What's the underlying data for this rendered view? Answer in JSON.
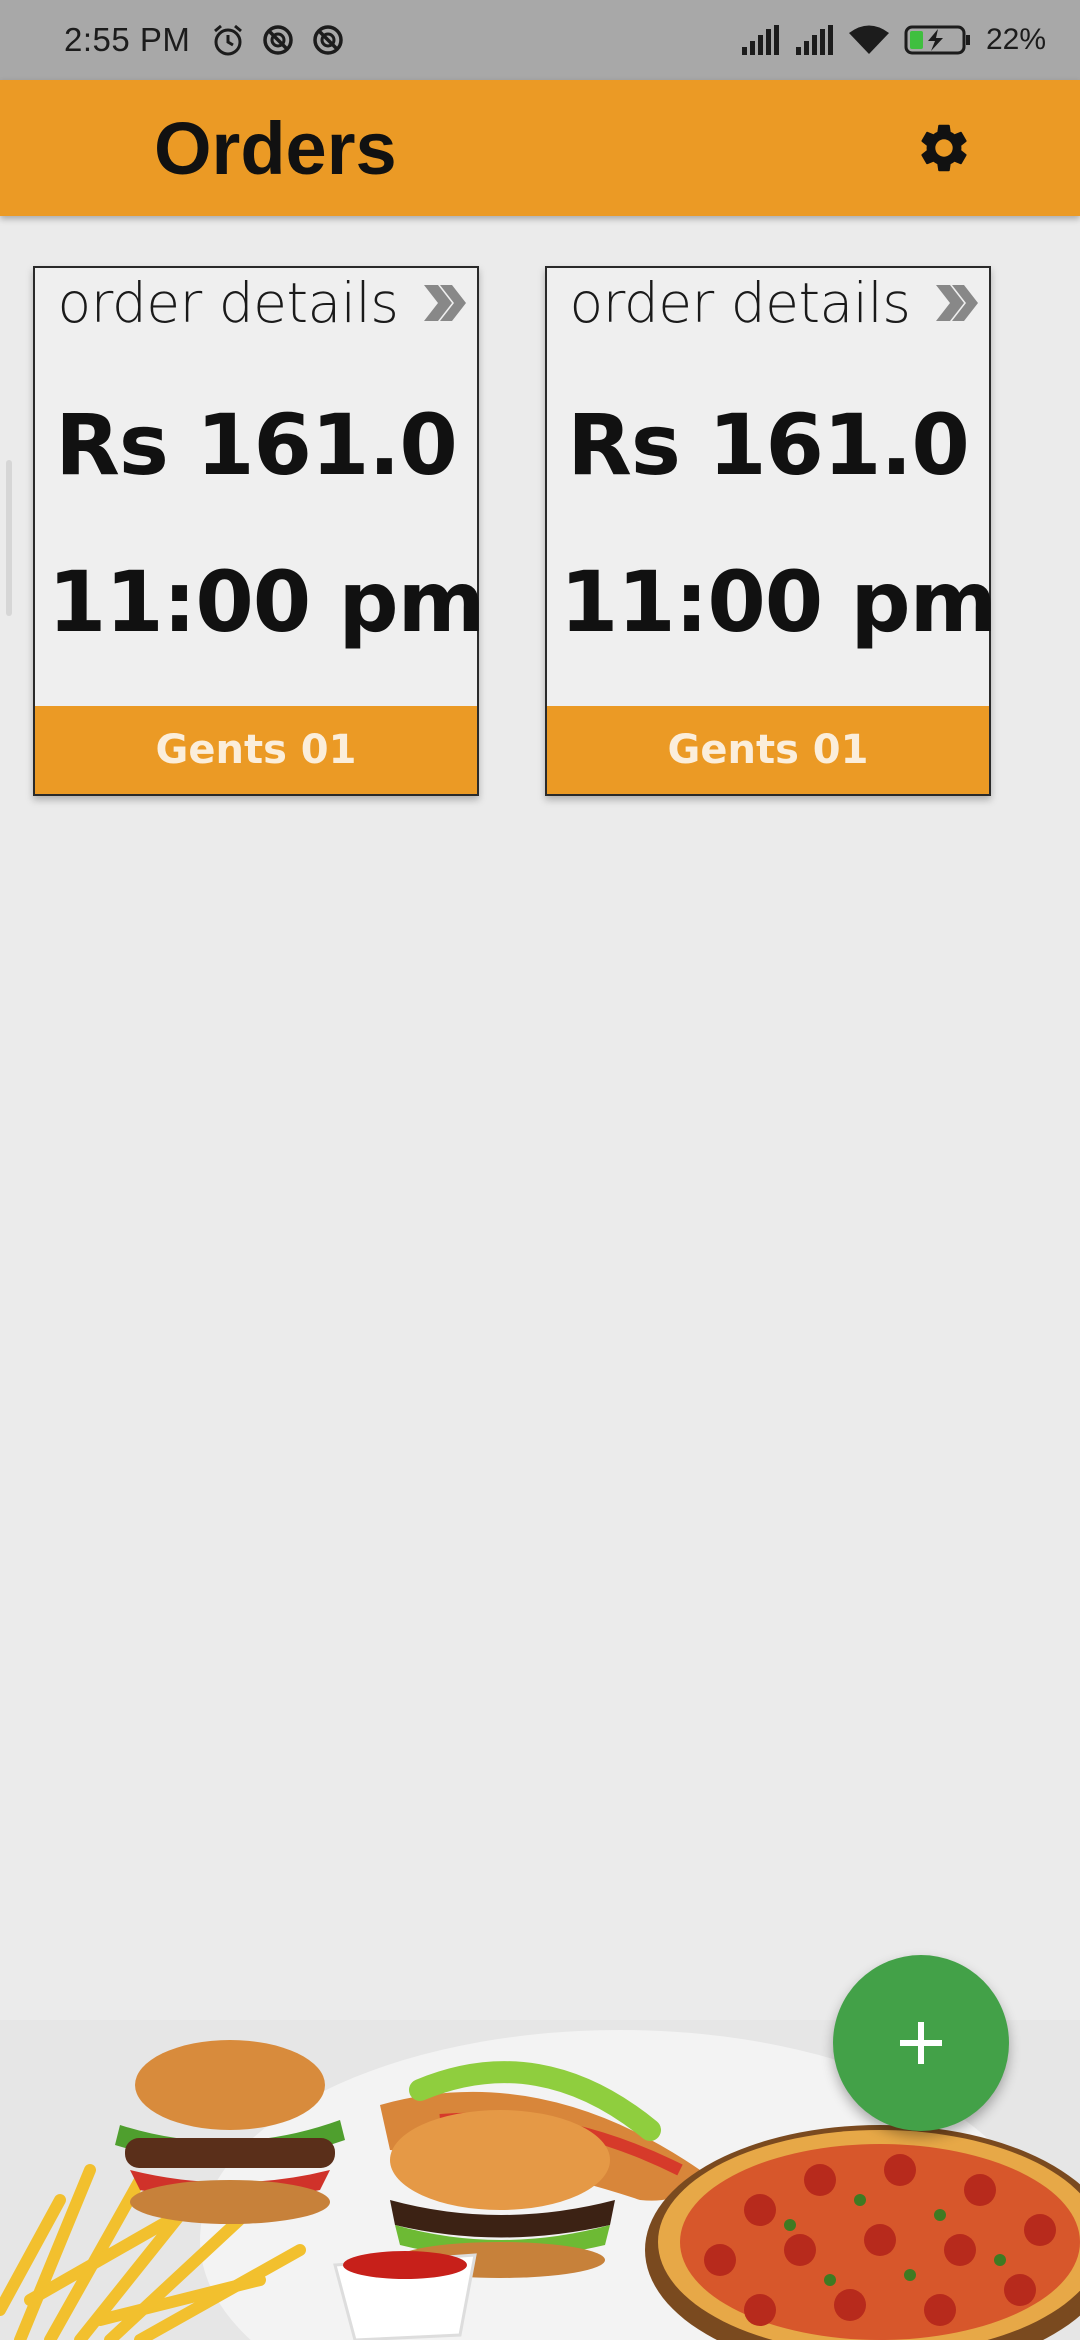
{
  "status_bar": {
    "time": "2:55 PM",
    "battery": "22%",
    "icons": [
      "alarm-icon",
      "sync-off-icon",
      "sync-off-icon",
      "signal-icon",
      "signal-icon",
      "wifi-icon",
      "battery-charging-icon"
    ]
  },
  "app_bar": {
    "title": "Orders",
    "settings_icon": "gear-icon"
  },
  "orders": [
    {
      "header": "order details",
      "amount": "Rs 161.0",
      "time": "11:00 pm",
      "label": "Gents 01"
    },
    {
      "header": "order details",
      "amount": "Rs 161.0",
      "time": "11:00 pm",
      "label": "Gents 01"
    }
  ],
  "fab": {
    "icon": "plus-icon"
  },
  "colors": {
    "accent": "#eb9a25",
    "fab": "#43a148",
    "background": "#ebebeb",
    "status_bar": "#a8a8a8"
  }
}
